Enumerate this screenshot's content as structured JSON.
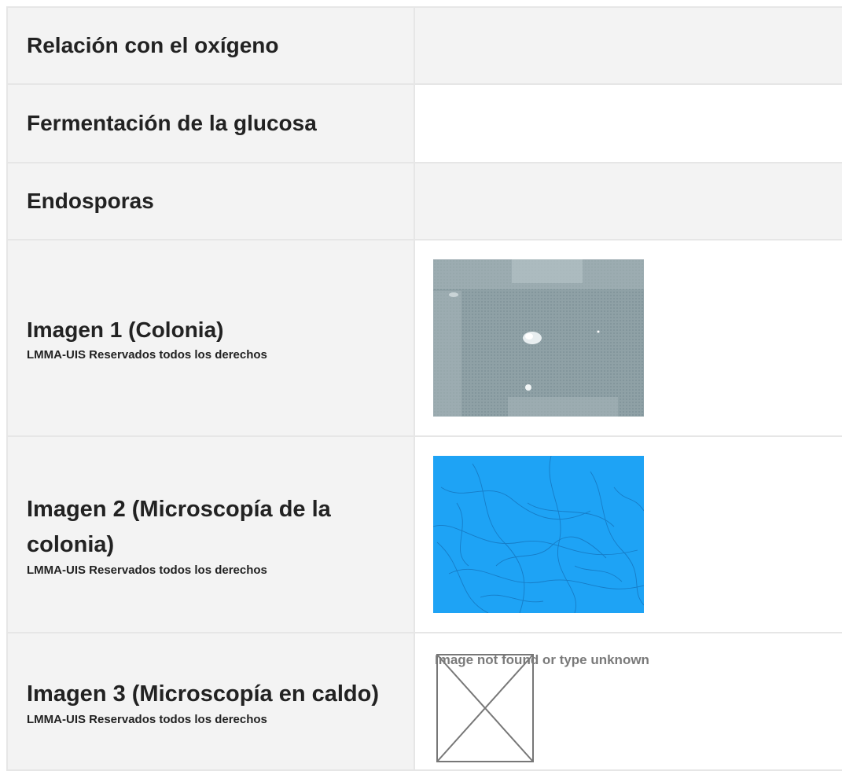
{
  "rows": [
    {
      "label": "Relación con el oxígeno"
    },
    {
      "label": "Fermentación de la glucosa"
    },
    {
      "label": "Endosporas"
    },
    {
      "label": "Imagen 1 (Colonia)",
      "copyright": "LMMA-UIS Reservados todos los derechos"
    },
    {
      "label": "Imagen 2 (Microscopía de la colonia)",
      "copyright": "LMMA-UIS Reservados todos los derechos"
    },
    {
      "label": "Imagen 3 (Microscopía en caldo)",
      "copyright": "LMMA-UIS Reservados todos los derechos",
      "image_alt": "Image not found or type unknown"
    }
  ],
  "colors": {
    "row_background": "#f3f3f3",
    "border": "#e6e6e6",
    "micro_blue": "#1ea3f5",
    "colony_gray": "#8c9ea3"
  }
}
